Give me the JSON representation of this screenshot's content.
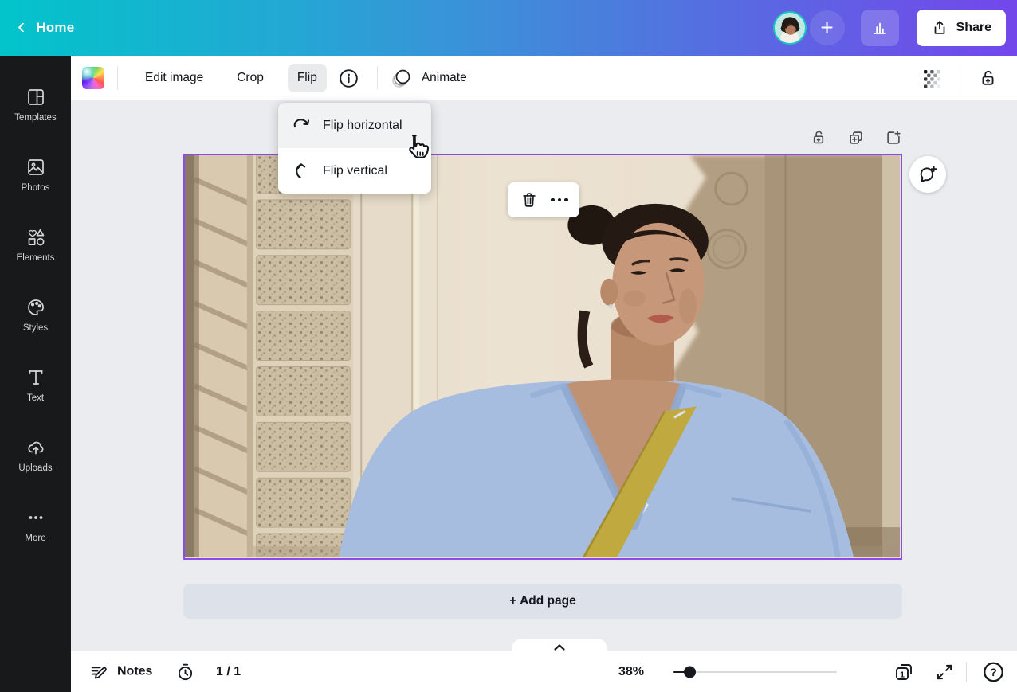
{
  "topbar": {
    "back_glyph": "‹",
    "home_label": "Home",
    "plus_glyph": "+",
    "share_label": "Share"
  },
  "sidebar": {
    "items": [
      {
        "label": "Templates",
        "icon": "templates-icon"
      },
      {
        "label": "Photos",
        "icon": "photos-icon"
      },
      {
        "label": "Elements",
        "icon": "elements-icon"
      },
      {
        "label": "Styles",
        "icon": "styles-icon"
      },
      {
        "label": "Text",
        "icon": "text-icon"
      },
      {
        "label": "Uploads",
        "icon": "uploads-icon"
      },
      {
        "label": "More",
        "icon": "more-icon"
      }
    ]
  },
  "toolbar": {
    "edit_image_label": "Edit image",
    "crop_label": "Crop",
    "flip_label": "Flip",
    "animate_label": "Animate"
  },
  "flip_menu": {
    "items": [
      {
        "label": "Flip horizontal",
        "icon": "flip-horizontal-icon",
        "highlighted": true
      },
      {
        "label": "Flip vertical",
        "icon": "flip-vertical-icon",
        "highlighted": false
      }
    ]
  },
  "canvas": {
    "add_page_label": "+ Add page"
  },
  "statusbar": {
    "notes_label": "Notes",
    "page_indicator": "1 / 1",
    "zoom_percent": "38%",
    "current_page": "1",
    "help_glyph": "?"
  },
  "colors": {
    "topbar_gradient_start": "#00c4cc",
    "topbar_gradient_end": "#7347eb",
    "sidebar_bg": "#18191b",
    "canvas_bg": "#ebecf0",
    "selection_border": "#8a4be8",
    "active_tool_bg": "#e9eaec",
    "add_page_bg": "#dde1ea"
  }
}
